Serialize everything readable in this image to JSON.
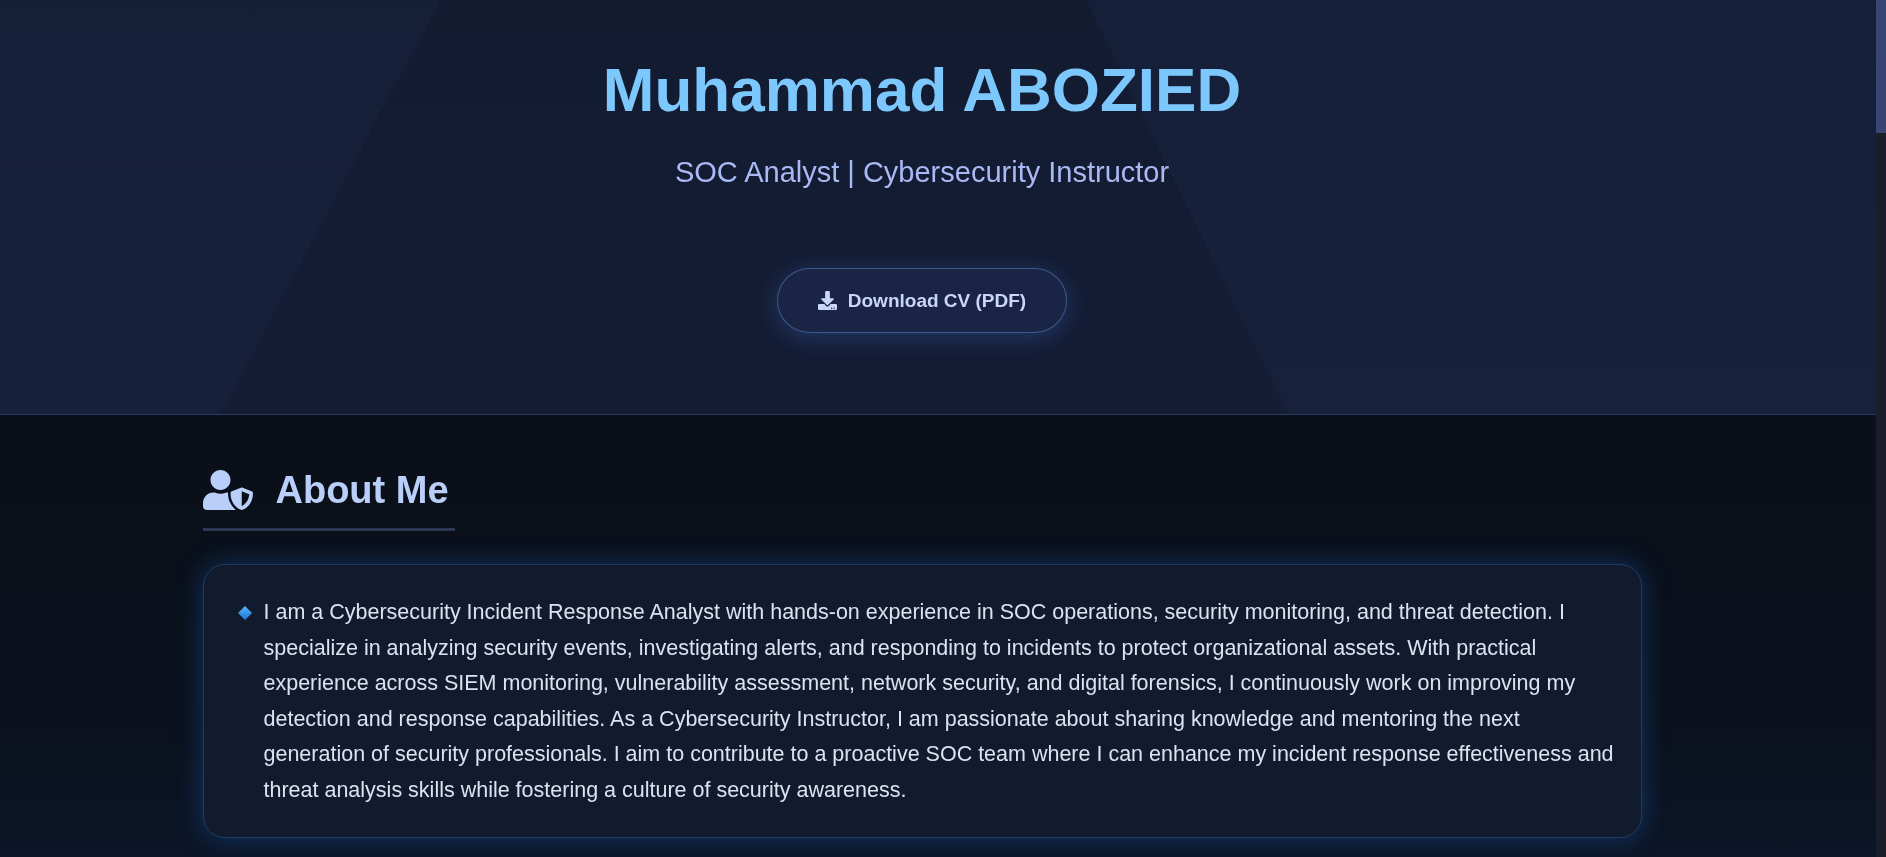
{
  "header": {
    "name": "Muhammad ABOZIED",
    "tagline": "SOC Analyst | Cybersecurity Instructor",
    "download_button": {
      "label": "Download CV (PDF)"
    }
  },
  "about": {
    "heading": "About Me",
    "paragraph": "I am a Cybersecurity Incident Response Analyst with hands-on experience in SOC operations, security monitoring, and threat detection. I specialize in analyzing security events, investigating alerts, and responding to incidents to protect organizational assets. With practical experience across SIEM monitoring, vulnerability assessment, network security, and digital forensics, I continuously work on improving my detection and response capabilities. As a Cybersecurity Instructor, I am passionate about sharing knowledge and mentoring the next generation of security professionals. I aim to contribute to a proactive SOC team where I can enhance my incident response effectiveness and threat analysis skills while fostering a culture of security awareness."
  }
}
